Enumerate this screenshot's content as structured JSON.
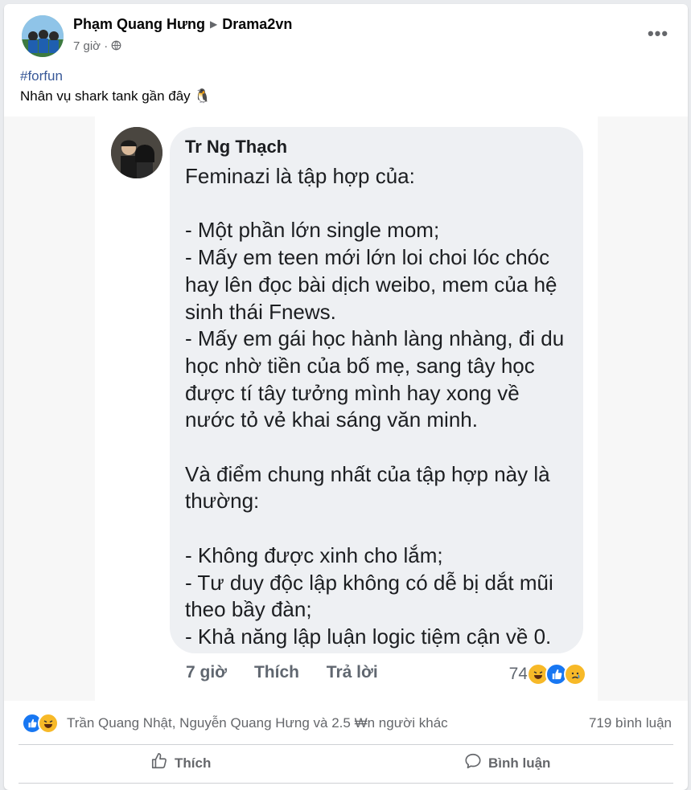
{
  "post": {
    "author": "Phạm Quang Hưng",
    "group": "Drama2vn",
    "time": "7 giờ",
    "audience_icon": "globe-icon",
    "hashtag": "#forfun",
    "text": "Nhân vụ shark tank gần đây",
    "text_emoji": "🐧"
  },
  "shared_comment": {
    "name": "Tr Ng Thạch",
    "lines": [
      "Feminazi là tập hợp của:",
      "",
      "- Một phần lớn single mom;",
      "- Mấy em teen mới lớn loi choi lóc chóc hay lên đọc bài dịch weibo, mem của hệ sinh thái Fnews.",
      "- Mấy em gái học hành làng nhàng, đi du học nhờ tiền của bố mẹ, sang tây học được tí tây tưởng mình hay xong về nước tỏ vẻ khai sáng văn minh.",
      "",
      "Và điểm chung nhất của tập hợp này là thường:",
      "",
      "- Không được xinh cho lắm;",
      "- Tư duy độc lập không có dễ bị dắt mũi theo bầy đàn;",
      "- Khả năng lập luận logic tiệm cận về 0."
    ],
    "time": "7 giờ",
    "like_label": "Thích",
    "reply_label": "Trả lời",
    "reaction_count": "74"
  },
  "reactions": {
    "names": "Trần Quang Nhật, Nguyễn Quang Hưng và 2.5 ₩n người khác",
    "comments": "719 bình luận"
  },
  "actions": {
    "like": "Thích",
    "comment": "Bình luận"
  },
  "colors": {
    "like_blue": "#1877f2",
    "haha_yellow": "#f7b928",
    "hashtag": "#385898",
    "muted": "#65676b"
  }
}
